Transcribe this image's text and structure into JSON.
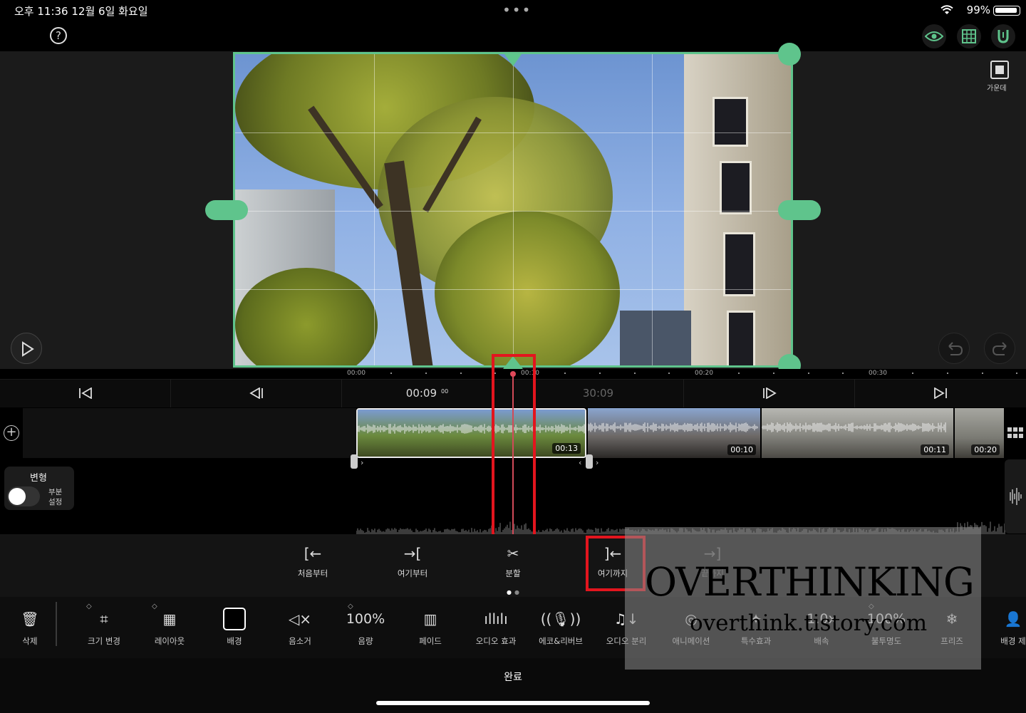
{
  "status": {
    "time_date": "오후 11:36   12월 6일 화요일",
    "battery": "99%",
    "dots": "•••"
  },
  "toolbar_top": {
    "help": "?",
    "center_label": "가운데"
  },
  "ruler": {
    "labels": [
      "00:00",
      "00:10",
      "00:20",
      "00:30"
    ]
  },
  "transport": {
    "current_time": "00:09",
    "frame": "00",
    "total_time": "30:09"
  },
  "clips": [
    {
      "duration": "00:13",
      "selected": true
    },
    {
      "duration": "00:10",
      "selected": false
    },
    {
      "duration": "00:11",
      "selected": false
    },
    {
      "duration": "00:20",
      "selected": false
    }
  ],
  "transform_panel": {
    "title": "변형",
    "toggle_label": "부분\n설정",
    "enabled": false
  },
  "actions": [
    {
      "label": "처음부터",
      "icon": "trim-start-icon",
      "glyph": "[←"
    },
    {
      "label": "여기부터",
      "icon": "from-here-icon",
      "glyph": "→["
    },
    {
      "label": "분할",
      "icon": "split-scissors-icon",
      "glyph": "✂"
    },
    {
      "label": "여기까지",
      "icon": "to-here-icon",
      "glyph": "]←"
    },
    {
      "label": "끝까지",
      "icon": "trim-end-icon",
      "glyph": "→]"
    }
  ],
  "tools": [
    {
      "label": "삭제",
      "icon": "trash-icon",
      "glyph": "🗑",
      "keyframe": false
    },
    {
      "label": "크기 변경",
      "icon": "crop-icon",
      "glyph": "⌗",
      "keyframe": true
    },
    {
      "label": "레이아웃",
      "icon": "layout-icon",
      "glyph": "▦",
      "keyframe": true
    },
    {
      "label": "배경",
      "icon": "background-swatch-icon",
      "glyph": "",
      "keyframe": false
    },
    {
      "label": "음소거",
      "icon": "mute-icon",
      "glyph": "◁×",
      "keyframe": false
    },
    {
      "label": "음량",
      "icon": "volume-value",
      "glyph": "100%",
      "keyframe": true
    },
    {
      "label": "페이드",
      "icon": "fade-icon",
      "glyph": "▥",
      "keyframe": false
    },
    {
      "label": "오디오 효과",
      "icon": "audio-effect-icon",
      "glyph": "ıllılı",
      "keyframe": false
    },
    {
      "label": "에코&리버브",
      "icon": "mic-echo-icon",
      "glyph": "((🎙))",
      "keyframe": false
    },
    {
      "label": "오디오 분리",
      "icon": "audio-split-icon",
      "glyph": "♫↓",
      "keyframe": false
    },
    {
      "label": "애니메이션",
      "icon": "animation-icon",
      "glyph": "◎",
      "keyframe": false
    },
    {
      "label": "특수효과",
      "icon": "effects-icon",
      "glyph": "✦",
      "keyframe": false
    },
    {
      "label": "배속",
      "icon": "speed-value",
      "glyph": "1.0x",
      "keyframe": false
    },
    {
      "label": "불투명도",
      "icon": "opacity-value",
      "glyph": "100%",
      "keyframe": true
    },
    {
      "label": "프리즈",
      "icon": "freeze-icon",
      "glyph": "❄",
      "keyframe": false
    },
    {
      "label": "배경 제",
      "icon": "bg-remove-icon",
      "glyph": "👤",
      "keyframe": false
    }
  ],
  "done_label": "완료",
  "watermark": {
    "line1": "OVERTHINKING",
    "line2": "overthink.tistory.com"
  },
  "colors": {
    "accent": "#5fc48c",
    "playhead": "#e0495a",
    "highlight_box": "#e3151e"
  }
}
